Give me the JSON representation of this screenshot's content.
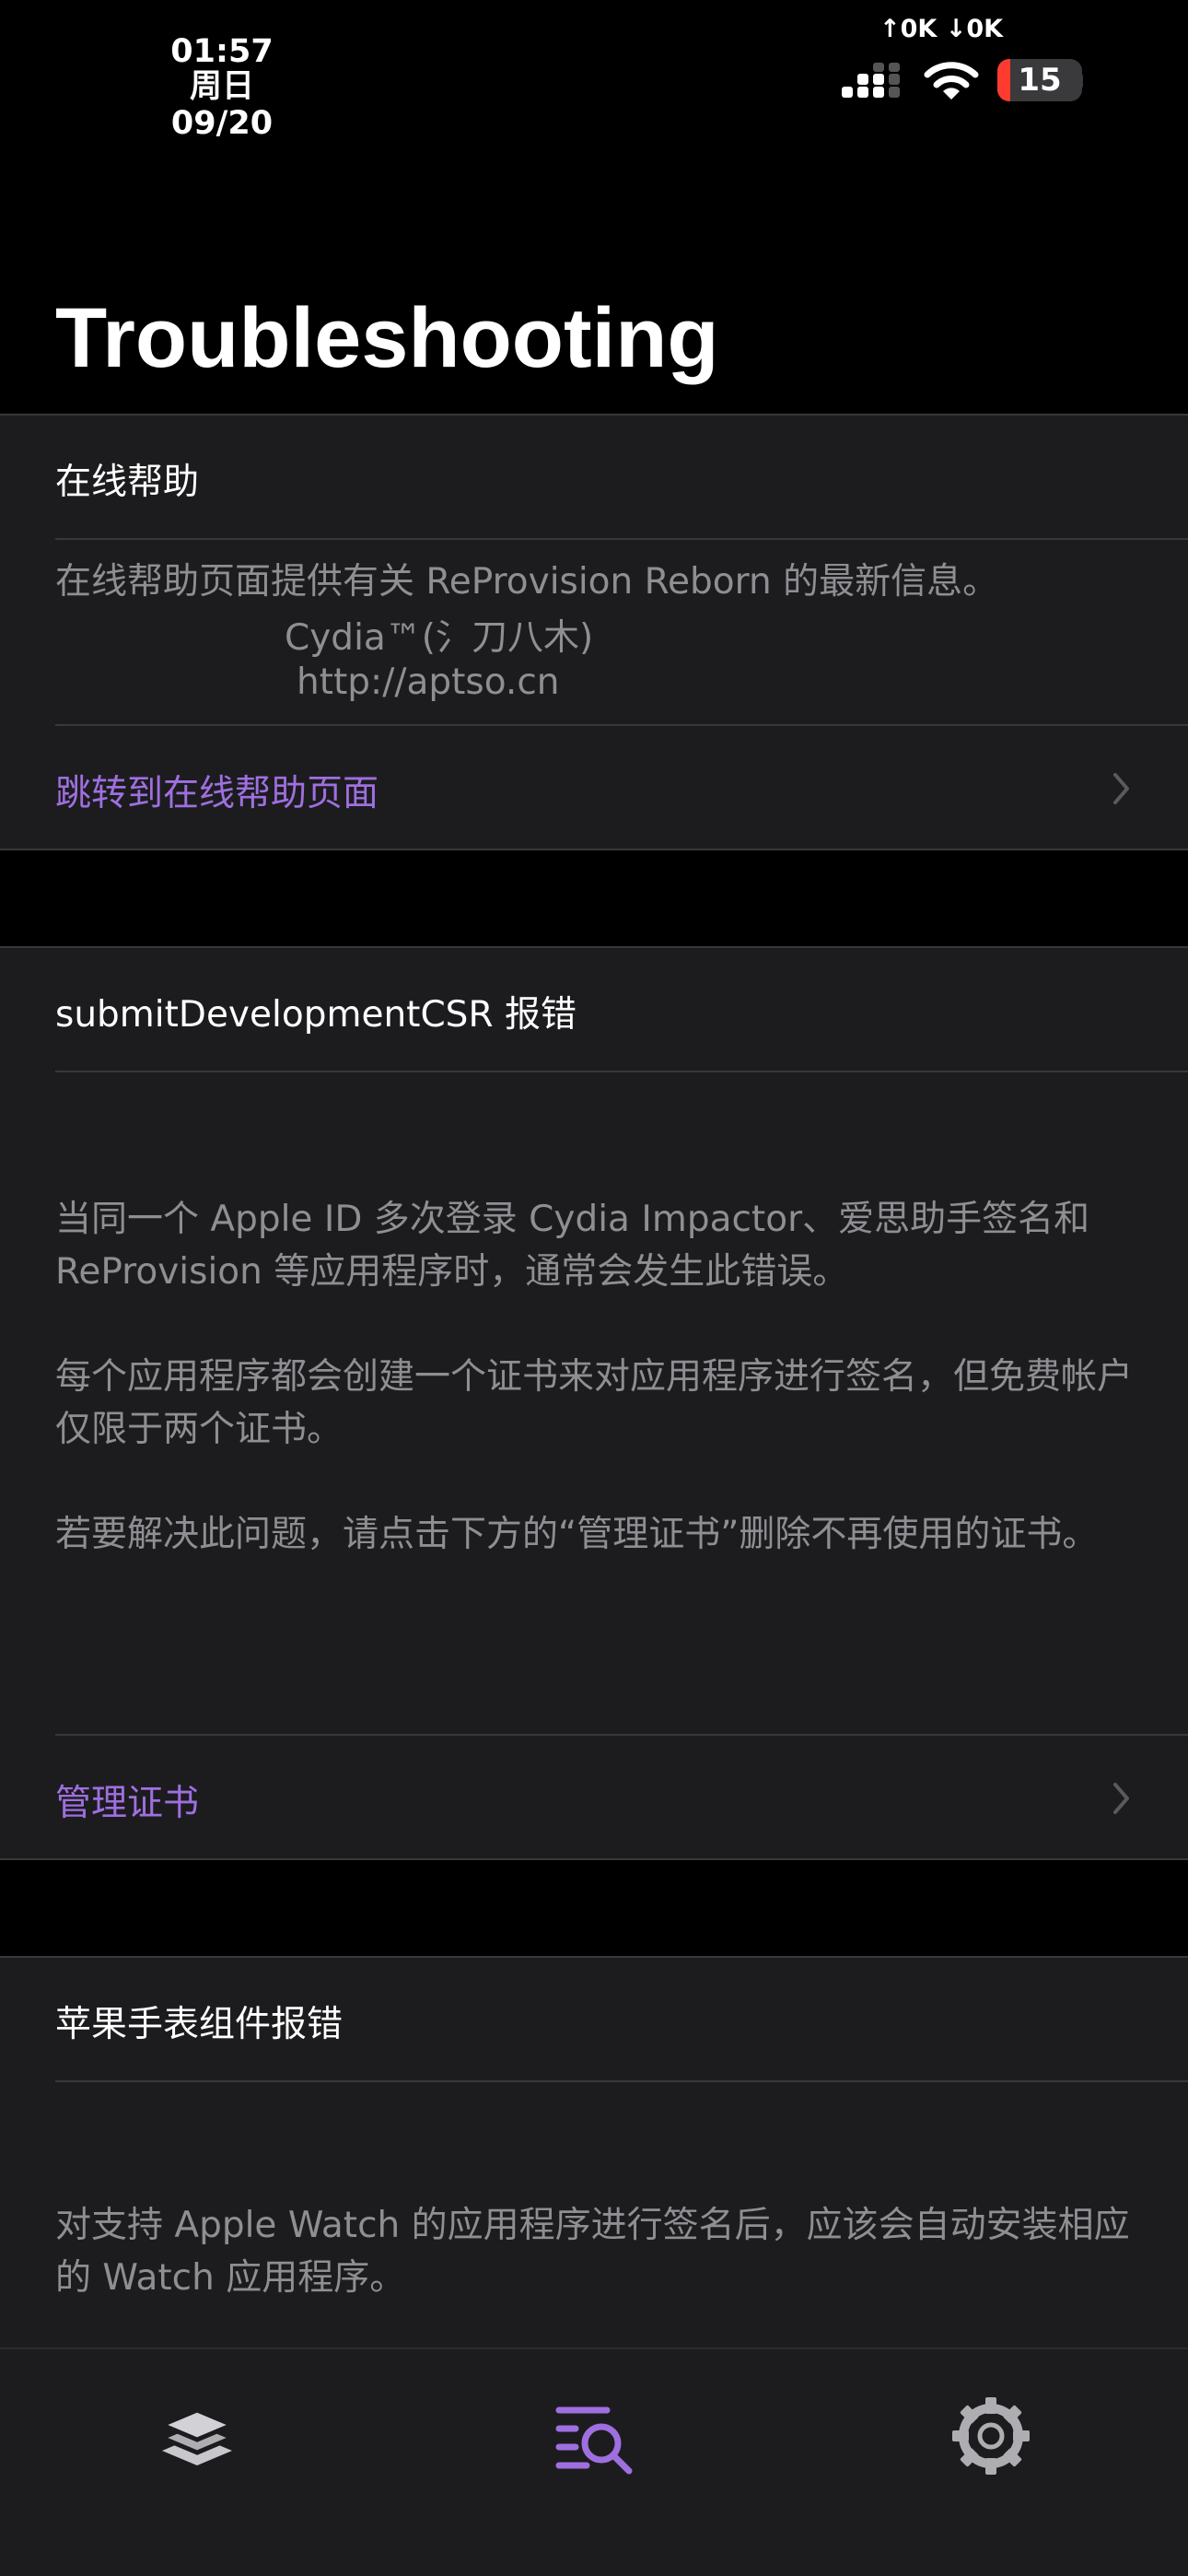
{
  "status_bar": {
    "time": "01:57",
    "date": "周日 09/20",
    "net_speed": "↑0K ↓0K",
    "battery_level": "15",
    "battery_color": "#ff3b30"
  },
  "page": {
    "title": "Troubleshooting"
  },
  "sections": {
    "online_help": {
      "header": "在线帮助",
      "description": "在线帮助页面提供有关 ReProvision Reborn 的最新信息。",
      "credit_line": "Cydia™(氵刀八木)",
      "url_line": "http://aptso.cn",
      "link": "跳转到在线帮助页面"
    },
    "csr_error": {
      "header": "submitDevelopmentCSR 报错",
      "paragraph_1": "当同一个 Apple ID 多次登录 Cydia Impactor、爱思助手签名和 ReProvision 等应用程序时，通常会发生此错误。",
      "paragraph_2": "每个应用程序都会创建一个证书来对应用程序进行签名，但免费帐户仅限于两个证书。",
      "paragraph_3": "若要解决此问题，请点击下方的“管理证书”删除不再使用的证书。",
      "link": "管理证书"
    },
    "watch_error": {
      "header": "苹果手表组件报错",
      "paragraph_1": "对支持 Apple Watch 的应用程序进行签名后，应该会自动安装相应的 Watch 应用程序。"
    }
  },
  "tabbar": {
    "active_tab": "troubleshooting",
    "accent_color": "#9f6fe0",
    "tabs": [
      {
        "icon": "layers-icon"
      },
      {
        "icon": "search-list-icon"
      },
      {
        "icon": "gear-icon"
      }
    ]
  }
}
